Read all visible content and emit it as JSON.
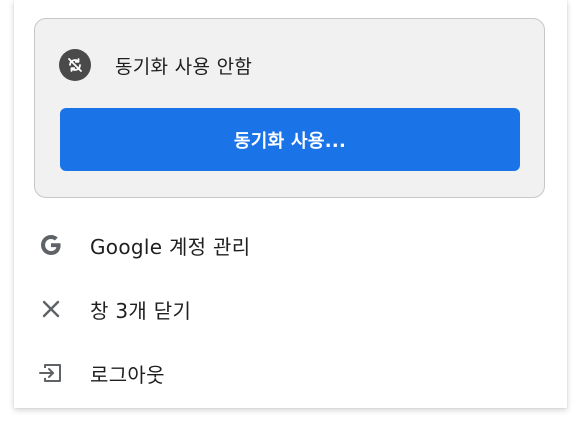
{
  "sync": {
    "status_icon": "sync-off-icon",
    "status_label": "동기화 사용 안함",
    "button_label": "동기화 사용..."
  },
  "menu": {
    "items": [
      {
        "icon": "google-icon",
        "label": "Google 계정 관리"
      },
      {
        "icon": "close-icon",
        "label": "창 3개 닫기"
      },
      {
        "icon": "logout-icon",
        "label": "로그아웃"
      }
    ]
  },
  "colors": {
    "accent": "#1b73e8",
    "card_background": "#f1f1f1",
    "icon_gray": "#5f6368"
  }
}
